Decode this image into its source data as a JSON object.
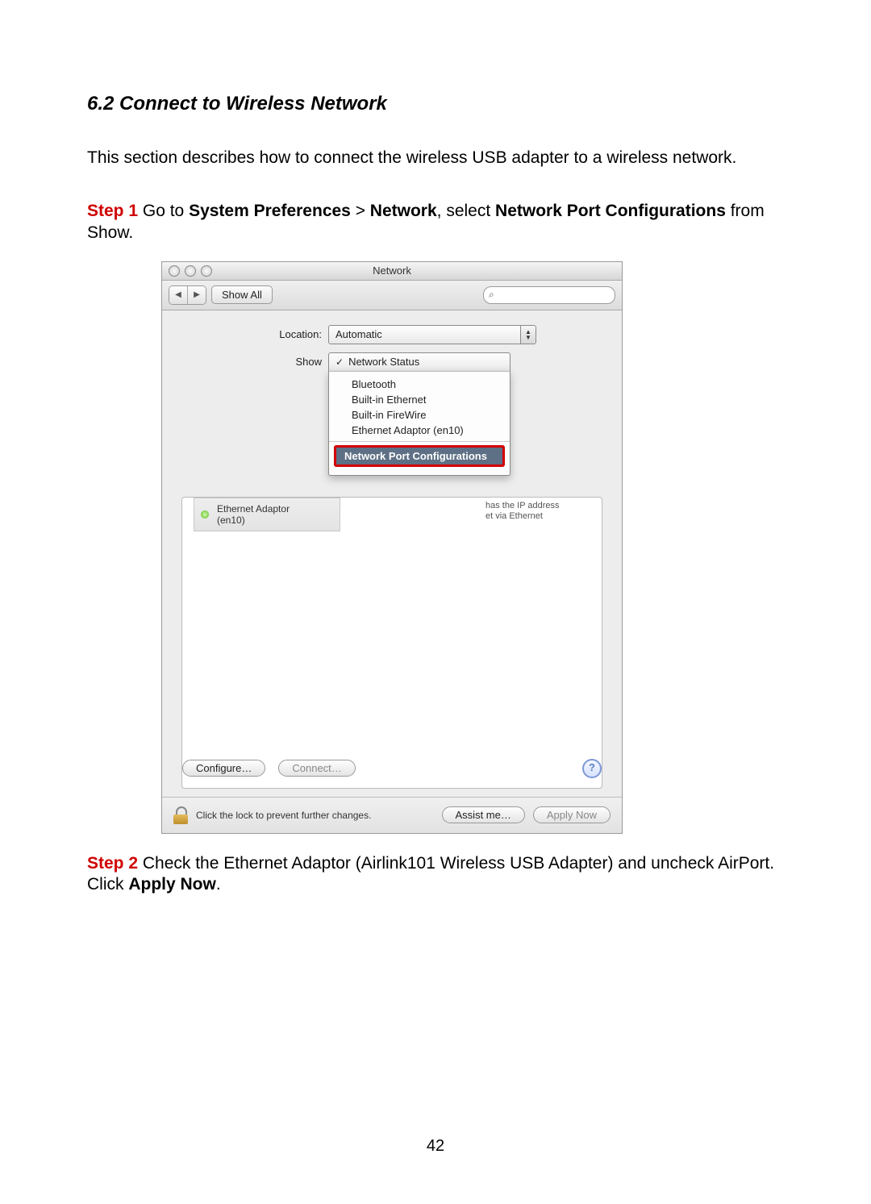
{
  "section_title": "6.2 Connect to Wireless Network",
  "intro_text": "This section describes how to connect the wireless USB adapter to a wireless network.",
  "step1": {
    "label": "Step 1",
    "segments": [
      " Go to ",
      "System Preferences",
      " > ",
      "Network",
      ", select ",
      "Network Port Configurations",
      " from Show."
    ]
  },
  "window": {
    "title": "Network",
    "show_all": "Show All",
    "search_placeholder": "",
    "location_label": "Location:",
    "location_value": "Automatic",
    "show_label": "Show",
    "show_selected": "Network Status",
    "menu_items": [
      "Bluetooth",
      "Built-in Ethernet",
      "Built-in FireWire",
      "Ethernet Adaptor (en10)"
    ],
    "menu_highlight": "Network Port Configurations",
    "adapter_name": "Ethernet Adaptor",
    "adapter_sub": "(en10)",
    "bg_info_line1": "has the IP address",
    "bg_info_line2": "et via Ethernet",
    "configure_btn": "Configure…",
    "connect_btn": "Connect…",
    "lock_text": "Click the lock to prevent further changes.",
    "assist_btn": "Assist me…",
    "apply_btn": "Apply Now"
  },
  "step2": {
    "label": "Step 2",
    "segments": [
      " Check the Ethernet Adaptor (Airlink101 Wireless USB Adapter) and uncheck AirPort. Click ",
      "Apply Now",
      "."
    ]
  },
  "page_number": "42"
}
